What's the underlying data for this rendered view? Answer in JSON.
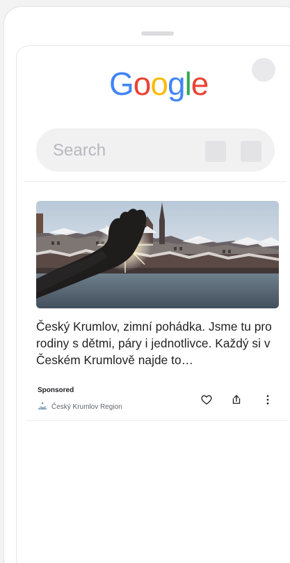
{
  "logo": {
    "letters": [
      "G",
      "o",
      "o",
      "g",
      "l",
      "e"
    ],
    "colors": [
      "#4285F4",
      "#EA4335",
      "#FBBC05",
      "#4285F4",
      "#34A853",
      "#EA4335"
    ]
  },
  "search": {
    "placeholder": "Search"
  },
  "ad": {
    "headline": "Český Krumlov, zimní pohádka. Jsme tu pro rodiny s dětmi, páry i jednotlivce. Každý si v Českém Krumlově najde to…",
    "sponsored_label": "Sponsored",
    "advertiser": "Český Krumlov Region"
  },
  "icons": {
    "heart": "heart-icon",
    "share": "share-icon",
    "more": "more-vertical-icon"
  },
  "colors": {
    "text": "#1f1f1f",
    "muted": "#5f6368",
    "surface": "#f1f1f2",
    "divider": "#ececee"
  }
}
